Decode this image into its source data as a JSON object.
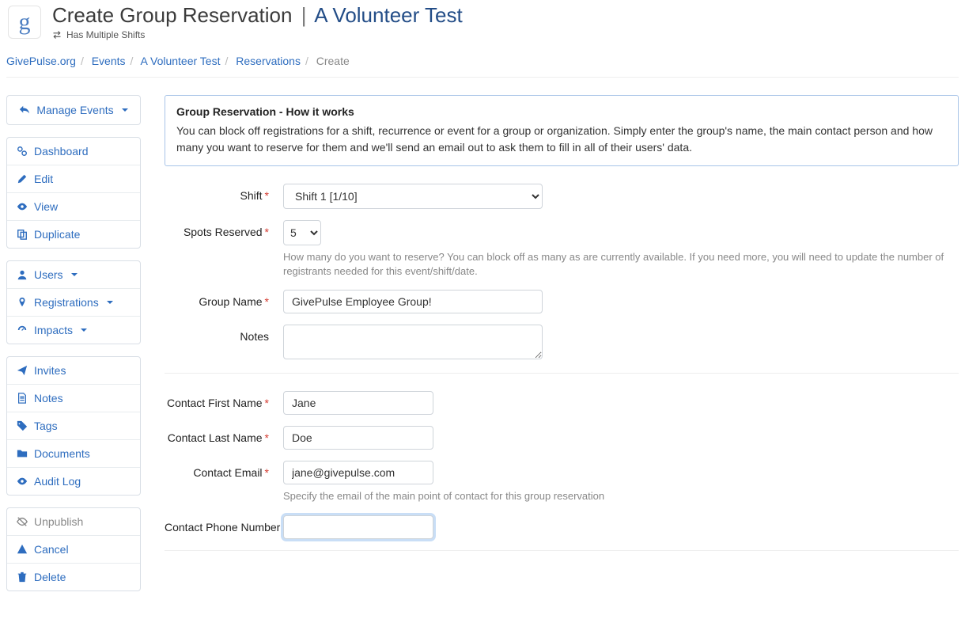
{
  "header": {
    "title_prefix": "Create Group Reservation",
    "event_name": "A Volunteer Test",
    "multi_shift_label": "Has Multiple Shifts",
    "logo_glyph": "g"
  },
  "breadcrumbs": {
    "items": [
      "GivePulse.org",
      "Events",
      "A Volunteer Test",
      "Reservations"
    ],
    "current": "Create"
  },
  "sidebar": {
    "manage_events": "Manage Events",
    "group1": [
      {
        "label": "Dashboard"
      },
      {
        "label": "Edit"
      },
      {
        "label": "View"
      },
      {
        "label": "Duplicate"
      }
    ],
    "group2": [
      {
        "label": "Users",
        "caret": true
      },
      {
        "label": "Registrations",
        "caret": true
      },
      {
        "label": "Impacts",
        "caret": true
      }
    ],
    "group3": [
      {
        "label": "Invites"
      },
      {
        "label": "Notes"
      },
      {
        "label": "Tags"
      },
      {
        "label": "Documents"
      },
      {
        "label": "Audit Log"
      }
    ],
    "group4": [
      {
        "label": "Unpublish",
        "muted": true
      },
      {
        "label": "Cancel"
      },
      {
        "label": "Delete"
      }
    ]
  },
  "infobox": {
    "title": "Group Reservation - How it works",
    "text": "You can block off registrations for a shift, recurrence or event for a group or organization. Simply enter the group's name, the main contact person and how many you want to reserve for them and we'll send an email out to ask them to fill in all of their users' data."
  },
  "form": {
    "shift": {
      "label": "Shift",
      "value": "Shift 1 [1/10]"
    },
    "spots": {
      "label": "Spots Reserved",
      "value": "5",
      "help": "How many do you want to reserve? You can block off as many as are currently available. If you need more, you will need to update the number of registrants needed for this event/shift/date."
    },
    "group_name": {
      "label": "Group Name",
      "value": "GivePulse Employee Group!"
    },
    "notes": {
      "label": "Notes",
      "value": ""
    },
    "first_name": {
      "label": "Contact First Name",
      "value": "Jane"
    },
    "last_name": {
      "label": "Contact Last Name",
      "value": "Doe"
    },
    "email": {
      "label": "Contact Email",
      "value": "jane@givepulse.com",
      "help": "Specify the email of the main point of contact for this group reservation"
    },
    "phone": {
      "label": "Contact Phone Number",
      "value": ""
    }
  }
}
